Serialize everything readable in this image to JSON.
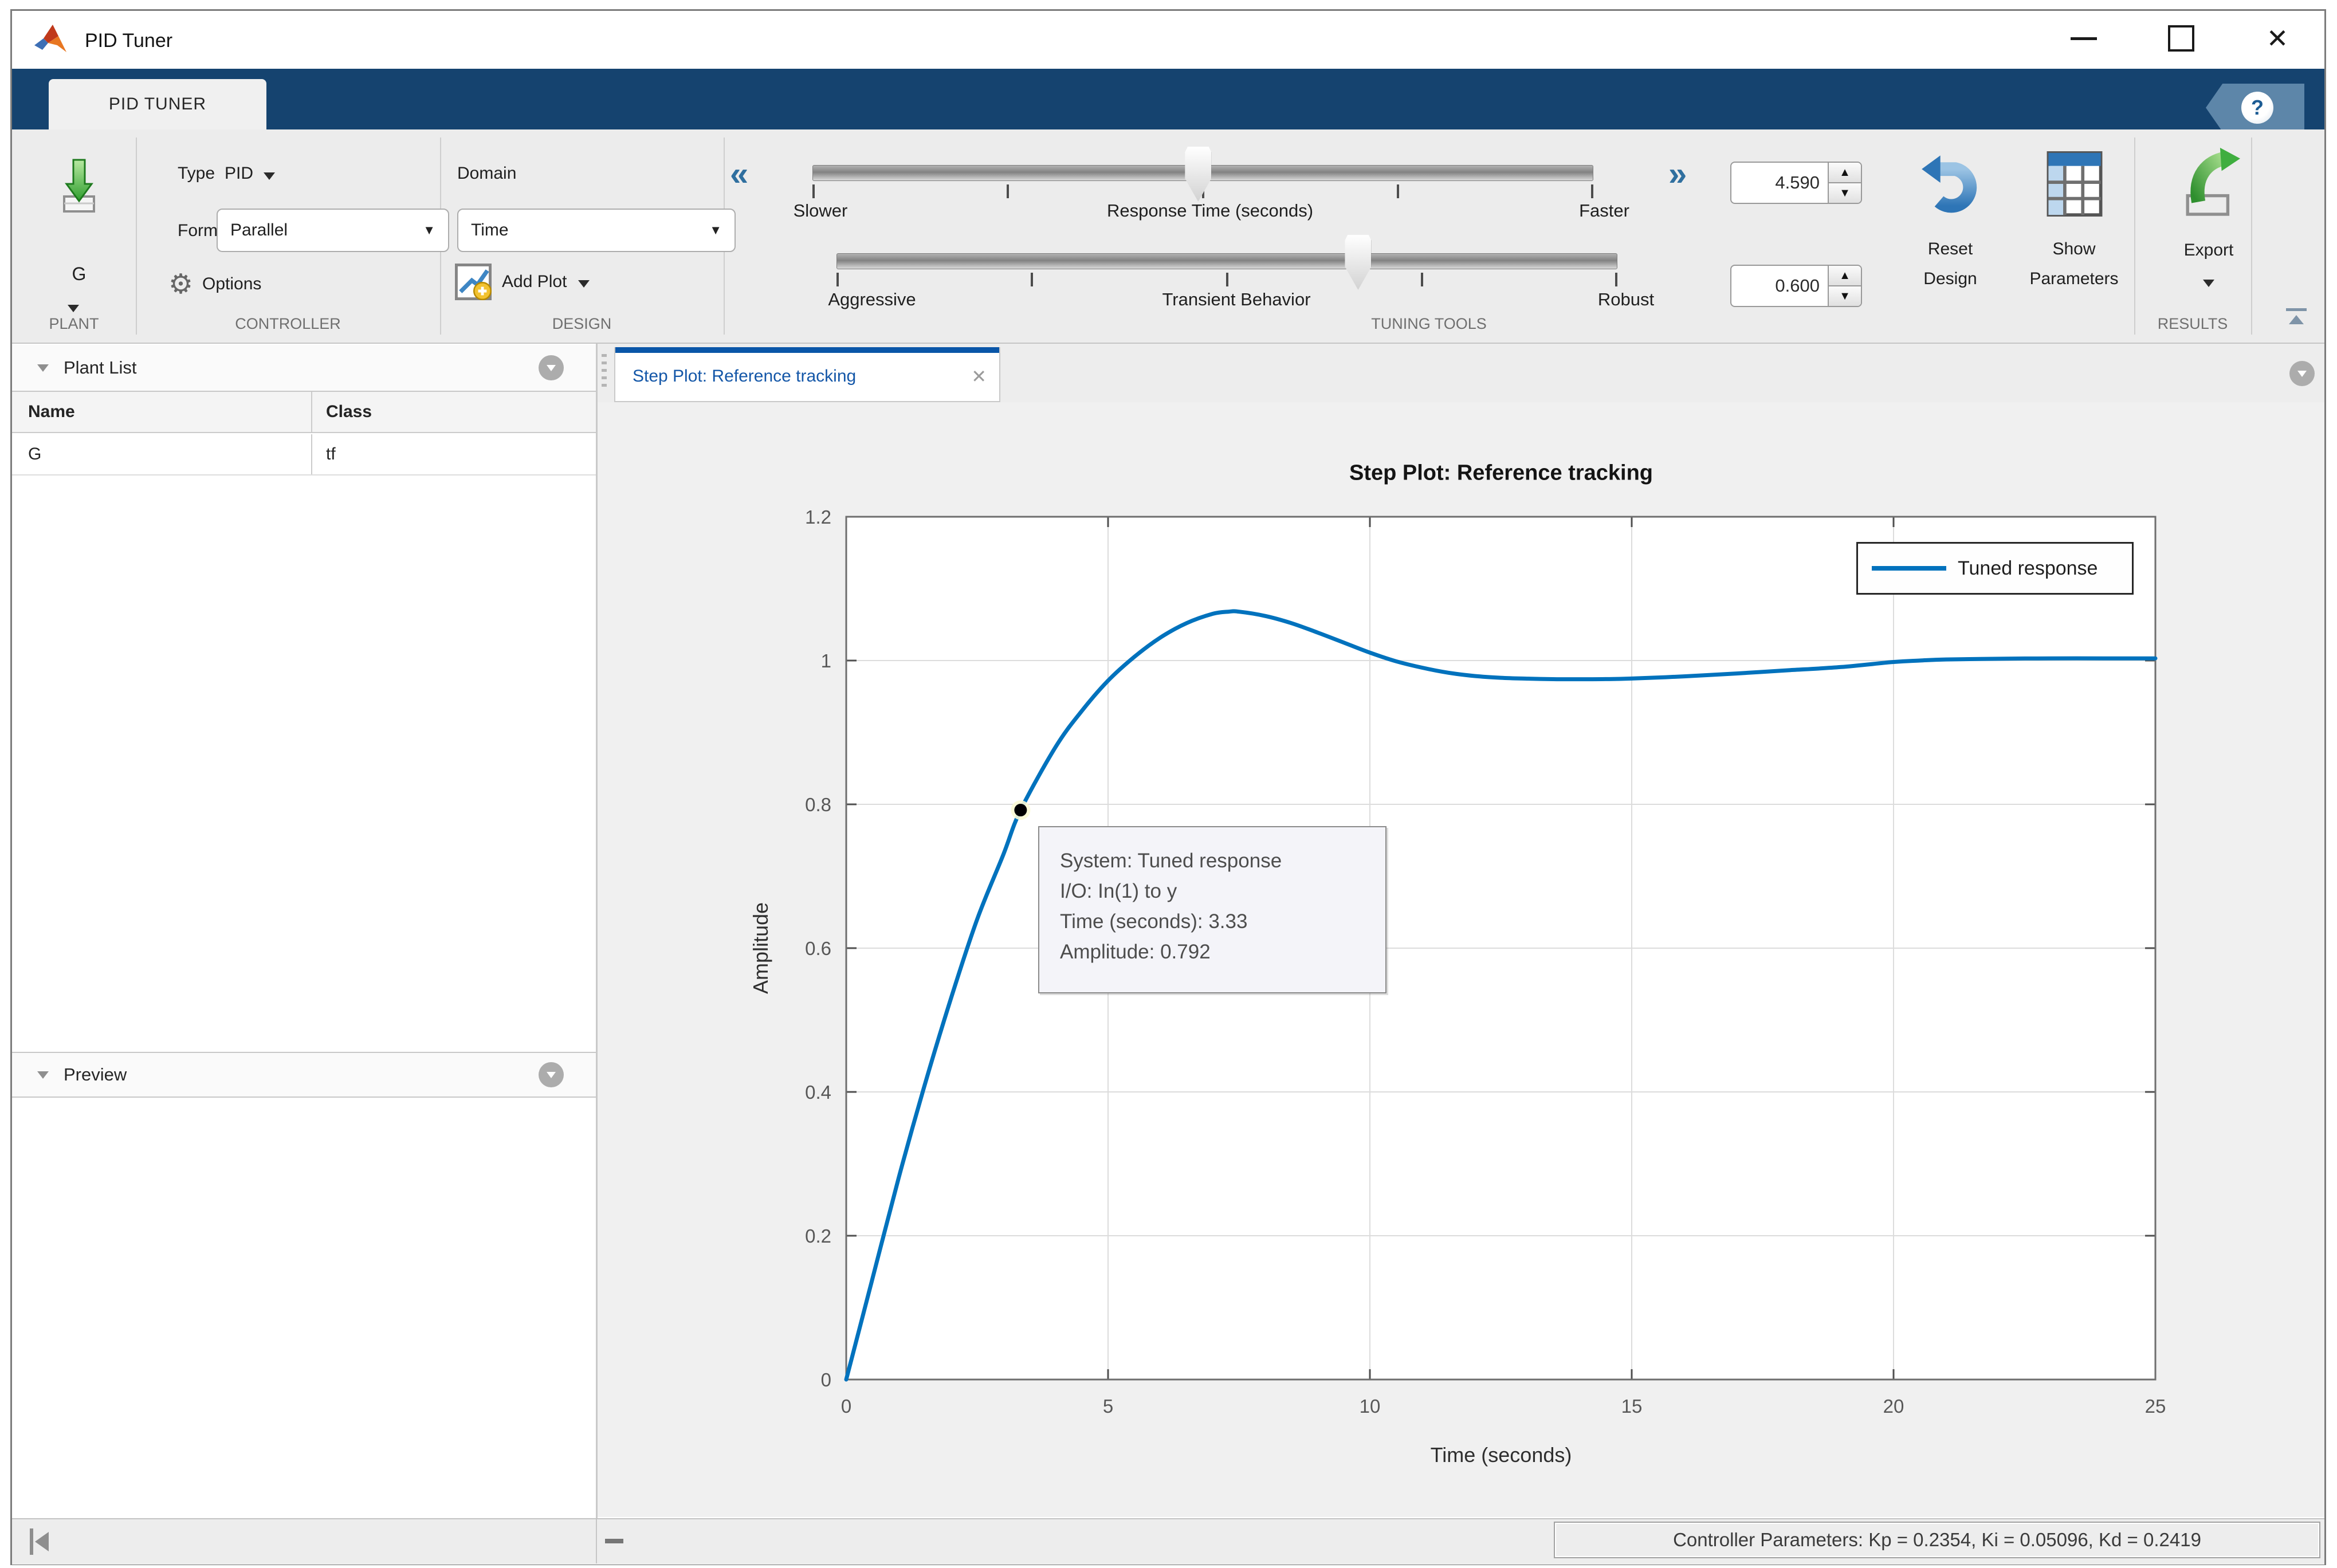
{
  "window": {
    "title": "PID Tuner"
  },
  "ribbon": {
    "tab_label": "PID TUNER",
    "plant": {
      "name": "G",
      "section_label": "PLANT"
    },
    "controller": {
      "type_label": "Type",
      "type_value": "PID",
      "form_label": "Form",
      "form_value": "Parallel",
      "options_label": "Options",
      "section_label": "CONTROLLER"
    },
    "design": {
      "domain_label": "Domain",
      "domain_value": "Time",
      "add_plot_label": "Add Plot",
      "section_label": "DESIGN"
    },
    "tuning": {
      "response_slider": {
        "left_label": "Slower",
        "title": "Response Time (seconds)",
        "right_label": "Faster",
        "value_percent": 49.4
      },
      "behavior_slider": {
        "left_label": "Aggressive",
        "title": "Transient Behavior",
        "right_label": "Robust",
        "value_percent": 66.8
      },
      "response_time_value": "4.590",
      "transient_behavior_value": "0.600",
      "reset_design_label_1": "Reset",
      "reset_design_label_2": "Design",
      "show_parameters_label_1": "Show",
      "show_parameters_label_2": "Parameters",
      "section_label": "TUNING TOOLS"
    },
    "results": {
      "export_label": "Export",
      "section_label": "RESULTS"
    }
  },
  "plant_list": {
    "title": "Plant List",
    "columns": [
      "Name",
      "Class"
    ],
    "rows": [
      {
        "name": "G",
        "class": "tf"
      }
    ]
  },
  "preview": {
    "title": "Preview"
  },
  "document": {
    "tab_title": "Step Plot: Reference tracking"
  },
  "chart_data": {
    "type": "line",
    "title": "Step Plot: Reference tracking",
    "xlabel": "Time (seconds)",
    "ylabel": "Amplitude",
    "xlim": [
      0,
      25
    ],
    "ylim": [
      0,
      1.2
    ],
    "xticks": [
      0,
      5,
      10,
      15,
      20,
      25
    ],
    "yticks": [
      0,
      0.2,
      0.4,
      0.6,
      0.8,
      1,
      1.2
    ],
    "grid": true,
    "legend": {
      "position": "northeast",
      "entries": [
        "Tuned response"
      ]
    },
    "series": [
      {
        "name": "Tuned response",
        "color": "#0072BD",
        "x": [
          0,
          0.5,
          1,
          1.5,
          2,
          2.5,
          3,
          3.33,
          4,
          4.5,
          5,
          5.5,
          6,
          6.5,
          7,
          7.3,
          7.5,
          8,
          8.5,
          9,
          9.5,
          10,
          10.5,
          11,
          11.5,
          12,
          12.5,
          13,
          13.5,
          14,
          14.5,
          15,
          16,
          17,
          18,
          19,
          20,
          20.5,
          21,
          22,
          23,
          24,
          25
        ],
        "y": [
          0,
          0.14,
          0.28,
          0.41,
          0.53,
          0.64,
          0.73,
          0.792,
          0.88,
          0.93,
          0.972,
          1.005,
          1.032,
          1.052,
          1.065,
          1.068,
          1.068,
          1.062,
          1.052,
          1.039,
          1.025,
          1.011,
          0.999,
          0.99,
          0.983,
          0.9785,
          0.976,
          0.9748,
          0.9741,
          0.974,
          0.9742,
          0.975,
          0.978,
          0.982,
          0.9865,
          0.991,
          0.998,
          1.0,
          1.0015,
          1.0025,
          1.003,
          1.003,
          1.003
        ]
      }
    ],
    "datatip": {
      "x": 3.33,
      "y": 0.792,
      "lines": [
        "System: Tuned response",
        "I/O: In(1) to y",
        "Time (seconds): 3.33",
        "Amplitude: 0.792"
      ]
    }
  },
  "status_bar": {
    "controller_parameters": "Controller Parameters: Kp = 0.2354, Ki = 0.05096, Kd = 0.2419"
  }
}
